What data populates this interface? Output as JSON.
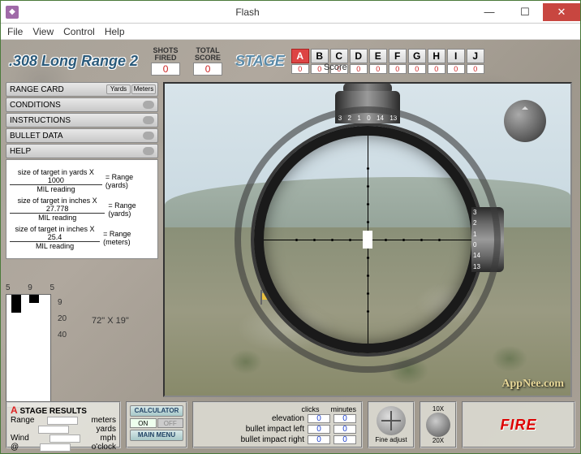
{
  "window": {
    "title": "Flash"
  },
  "menubar": [
    "File",
    "View",
    "Control",
    "Help"
  ],
  "game_title": ".308 Long Range 2",
  "shots_fired": {
    "label1": "SHOTS",
    "label2": "FIRED",
    "value": "0"
  },
  "total_score": {
    "label1": "TOTAL",
    "label2": "SCORE",
    "value": "0"
  },
  "stage_label": "STAGE",
  "score_label": "Score",
  "stages": [
    {
      "letter": "A",
      "score": "0",
      "active": true
    },
    {
      "letter": "B",
      "score": "0",
      "active": false
    },
    {
      "letter": "C",
      "score": "0",
      "active": false
    },
    {
      "letter": "D",
      "score": "0",
      "active": false
    },
    {
      "letter": "E",
      "score": "0",
      "active": false
    },
    {
      "letter": "F",
      "score": "0",
      "active": false
    },
    {
      "letter": "G",
      "score": "0",
      "active": false
    },
    {
      "letter": "H",
      "score": "0",
      "active": false
    },
    {
      "letter": "I",
      "score": "0",
      "active": false
    },
    {
      "letter": "J",
      "score": "0",
      "active": false
    }
  ],
  "side_buttons": {
    "range_card": "RANGE CARD",
    "unit_yards": "Yards",
    "unit_meters": "Meters",
    "conditions": "CONDITIONS",
    "instructions": "INSTRUCTIONS",
    "bullet_data": "BULLET DATA",
    "help": "HELP"
  },
  "formulas": [
    {
      "num": "size of target in yards X 1000",
      "den": "MIL reading",
      "eq": "= Range (yards)"
    },
    {
      "num": "size of target in inches X 27.778",
      "den": "MIL reading",
      "eq": "= Range (yards)"
    },
    {
      "num": "size of target in inches X 25.4",
      "den": "MIL reading",
      "eq": "= Range (meters)"
    }
  ],
  "mini": {
    "scale": [
      "5",
      "9",
      "5"
    ],
    "side": [
      "9",
      "20",
      "40"
    ],
    "dim": "72\" X 19\""
  },
  "turret_top_marks": [
    "3",
    "2",
    "1",
    "0",
    "14",
    "13"
  ],
  "turret_right_marks": [
    "3",
    "2",
    "1",
    "0",
    "14",
    "13"
  ],
  "results": {
    "title_letter": "A",
    "title_text": " STAGE RESULTS",
    "rows": [
      {
        "label": "Range",
        "unit": "meters"
      },
      {
        "label": "",
        "unit": "yards"
      },
      {
        "label": "Wind",
        "unit": "mph"
      },
      {
        "label": "@",
        "unit": "o'clock"
      }
    ]
  },
  "calc": {
    "calculator": "CALCULATOR",
    "on": "ON",
    "off": "OFF",
    "main_menu": "MAIN MENU"
  },
  "impact": {
    "hdr_clicks": "clicks",
    "hdr_minutes": "minutes",
    "rows": [
      {
        "label": "elevation",
        "clicks": "0",
        "minutes": "0"
      },
      {
        "label": "bullet impact left",
        "clicks": "0",
        "minutes": "0"
      },
      {
        "label": "bullet impact right",
        "clicks": "0",
        "minutes": "0"
      }
    ]
  },
  "fine_adjust": "Fine adjust",
  "zoom": {
    "top": "10X",
    "bottom": "20X"
  },
  "fire": "FIRE",
  "watermark": "AppNee.com"
}
